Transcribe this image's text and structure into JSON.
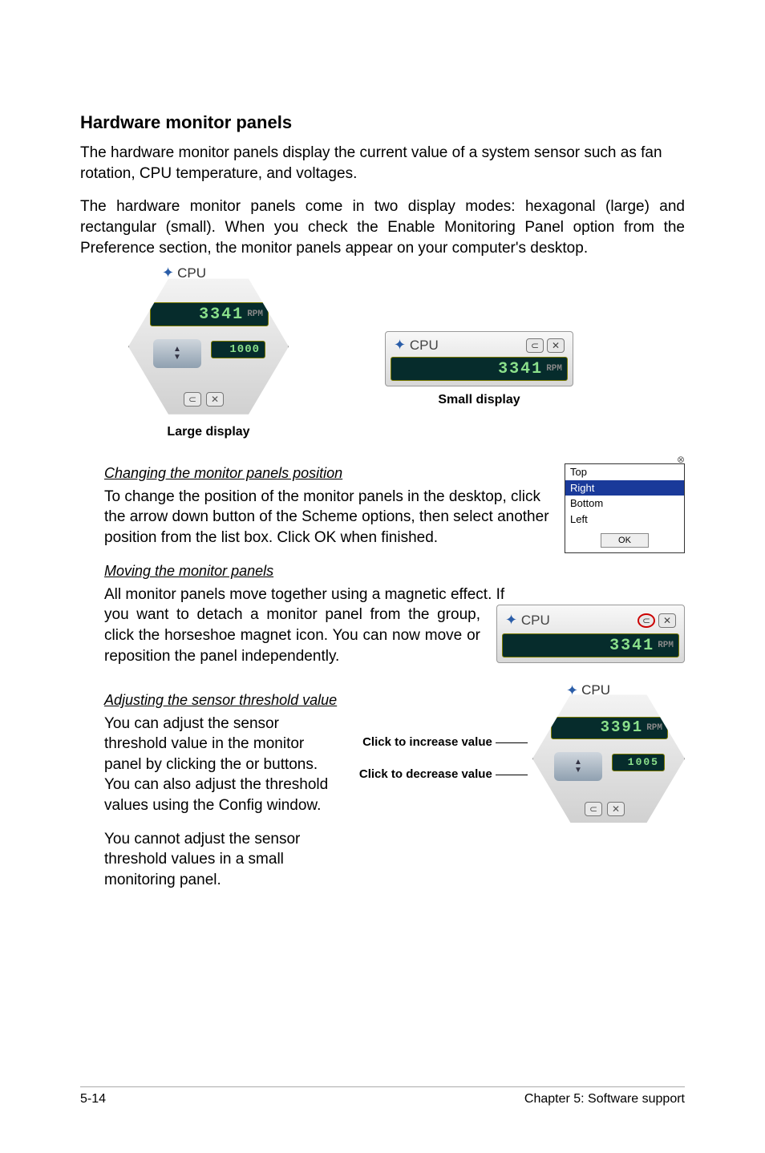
{
  "title": "Hardware monitor panels",
  "p1": "The hardware monitor panels display the current value of a system sensor such as fan rotation, CPU temperature, and voltages.",
  "p2": "The hardware monitor panels come in two display modes: hexagonal (large) and rectangular (small). When you check the Enable Monitoring Panel option from the Preference section, the monitor panels appear on your computer's desktop.",
  "large_caption": "Large display",
  "small_caption": "Small display",
  "hex": {
    "title": "CPU",
    "value": "3341",
    "unit": "RPM",
    "threshold": "1000"
  },
  "small": {
    "title": "CPU",
    "value": "3341",
    "unit": "RPM"
  },
  "sec1_head": "Changing the monitor panels position",
  "sec1_body": "To change the position of the monitor panels in the desktop, click the arrow down button of the Scheme options, then select another position from the list box. Click OK when finished.",
  "listbox": {
    "items": [
      "Top",
      "Right",
      "Bottom",
      "Left"
    ],
    "selected": "Right",
    "ok": "OK"
  },
  "sec2_head": "Moving the monitor panels",
  "sec2_lead": "All monitor panels move together using a magnetic effect. If",
  "sec2_rest": "you want to detach a monitor panel from the group, click the horseshoe magnet icon. You can now move or reposition the panel independently.",
  "magnet_widget": {
    "title": "CPU",
    "value": "3341",
    "unit": "RPM"
  },
  "sec3_head": "Adjusting the sensor threshold value",
  "sec3_p1": "You can adjust the sensor threshold value in the monitor panel by clicking the  or  buttons. You can also adjust the threshold values using the Config window.",
  "sec3_p2": "You cannot adjust the sensor threshold values in a small monitoring panel.",
  "adjust_widget": {
    "title": "CPU",
    "value": "3391",
    "unit": "RPM",
    "threshold": "1005"
  },
  "adj_inc": "Click to increase value",
  "adj_dec": "Click to decrease value",
  "footer_left": "5-14",
  "footer_right": "Chapter 5: Software support"
}
